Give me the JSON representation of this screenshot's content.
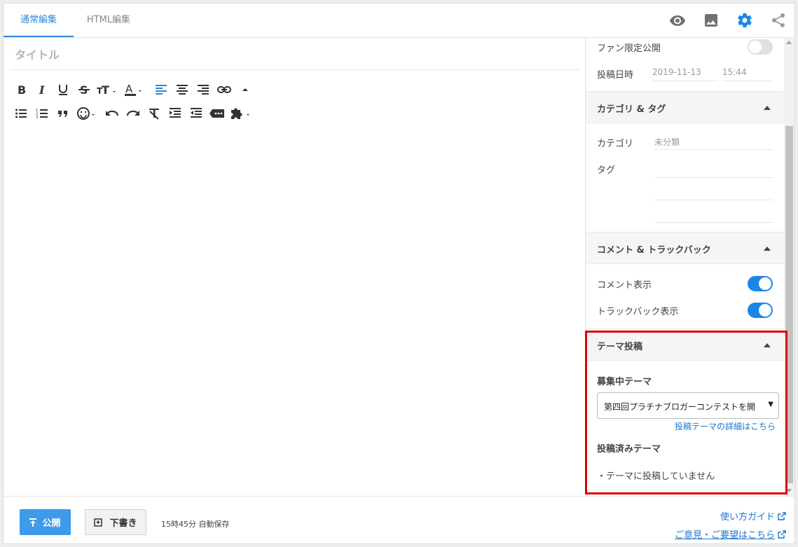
{
  "tabs": {
    "normal": "通常編集",
    "html": "HTML編集"
  },
  "top_icons": [
    "eye-icon",
    "image-icon",
    "gear-icon",
    "share-icon"
  ],
  "editor": {
    "title_placeholder": "タイトル"
  },
  "toolbar": {
    "row1": [
      "bold",
      "italic",
      "underline",
      "strikethrough",
      "font-size",
      "font-color",
      "align-left",
      "align-center",
      "align-right",
      "link",
      "collapse"
    ],
    "row2": [
      "bullet-list",
      "numbered-list",
      "quote",
      "emoji",
      "undo",
      "redo",
      "clear-format",
      "indent",
      "outdent",
      "more",
      "plugin"
    ]
  },
  "sidebar": {
    "fan_only_label": "ファン限定公開",
    "fan_only_on": false,
    "post_datetime_label": "投稿日時",
    "post_date": "2019-11-13",
    "post_time": "15:44",
    "category_section": "カテゴリ & タグ",
    "category_label": "カテゴリ",
    "category_value": "未分類",
    "tag_label": "タグ",
    "comment_section": "コメント & トラックバック",
    "comment_display_label": "コメント表示",
    "comment_display_on": true,
    "trackback_display_label": "トラックバック表示",
    "trackback_display_on": true,
    "theme_section": "テーマ投稿",
    "recruiting_theme_label": "募集中テーマ",
    "recruiting_theme_value": "第四回プラチナブロガーコンテストを開",
    "theme_detail_link": "投稿テーマの詳細はこちら",
    "posted_theme_label": "投稿済みテーマ",
    "posted_theme_value": "・テーマに投稿していません"
  },
  "footer": {
    "publish_label": "公開",
    "draft_label": "下書き",
    "autosave_text": "15時45分 自動保存",
    "guide_link": "使い方ガイド",
    "feedback_link": "ご意見・ご要望はこちら"
  },
  "colors": {
    "accent": "#2e89d7",
    "toggle_on": "#1a86e8",
    "highlight_box": "#e00000",
    "publish_button": "#3d9bea"
  }
}
